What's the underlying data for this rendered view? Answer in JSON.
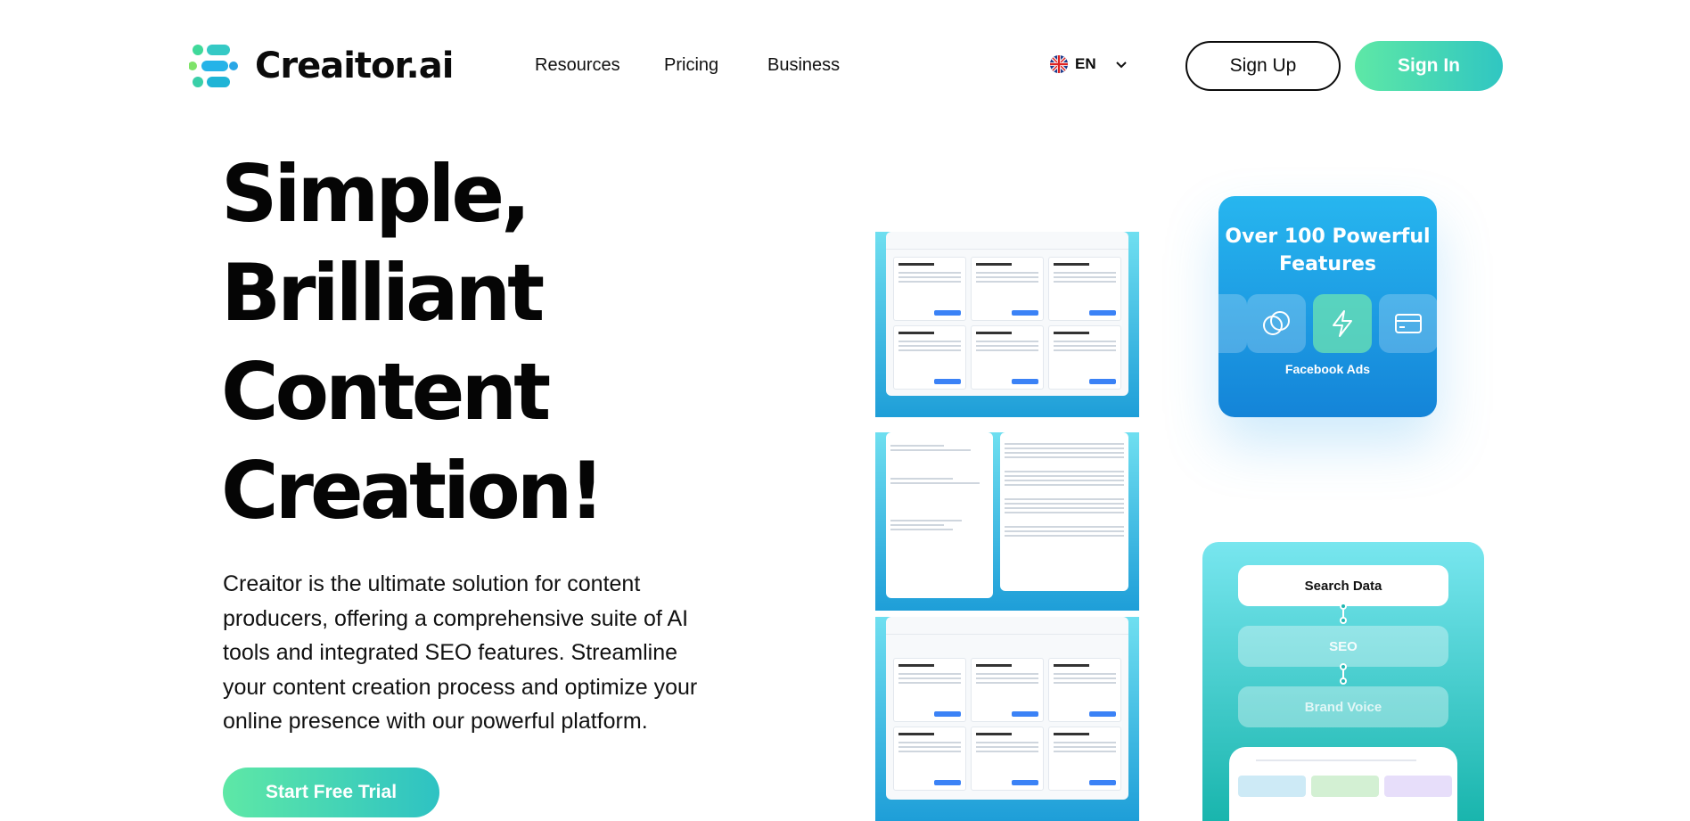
{
  "brand": {
    "name": "Creaitor.ai"
  },
  "nav": {
    "links": [
      "Resources",
      "Pricing",
      "Business"
    ],
    "language": "EN",
    "sign_up": "Sign Up",
    "sign_in": "Sign In"
  },
  "hero": {
    "title_lines": [
      "Simple,",
      "Brilliant",
      "Content",
      "Creation!"
    ],
    "description": "Creaitor is the ultimate solution for content producers, offering a comprehensive suite of AI tools and integrated SEO features. Streamline your content creation process and optimize your online presence with our powerful platform.",
    "cta": "Start Free Trial"
  },
  "showcase": {
    "feature_title": "Over 100 Powerful Features",
    "feature_label": "Facebook Ads",
    "flow_steps": [
      "Search Data",
      "SEO",
      "Brand Voice"
    ]
  },
  "colors": {
    "accent_green": "#5ee8a6",
    "accent_teal": "#30c6c2",
    "feature_blue": "#1e9ed8"
  }
}
